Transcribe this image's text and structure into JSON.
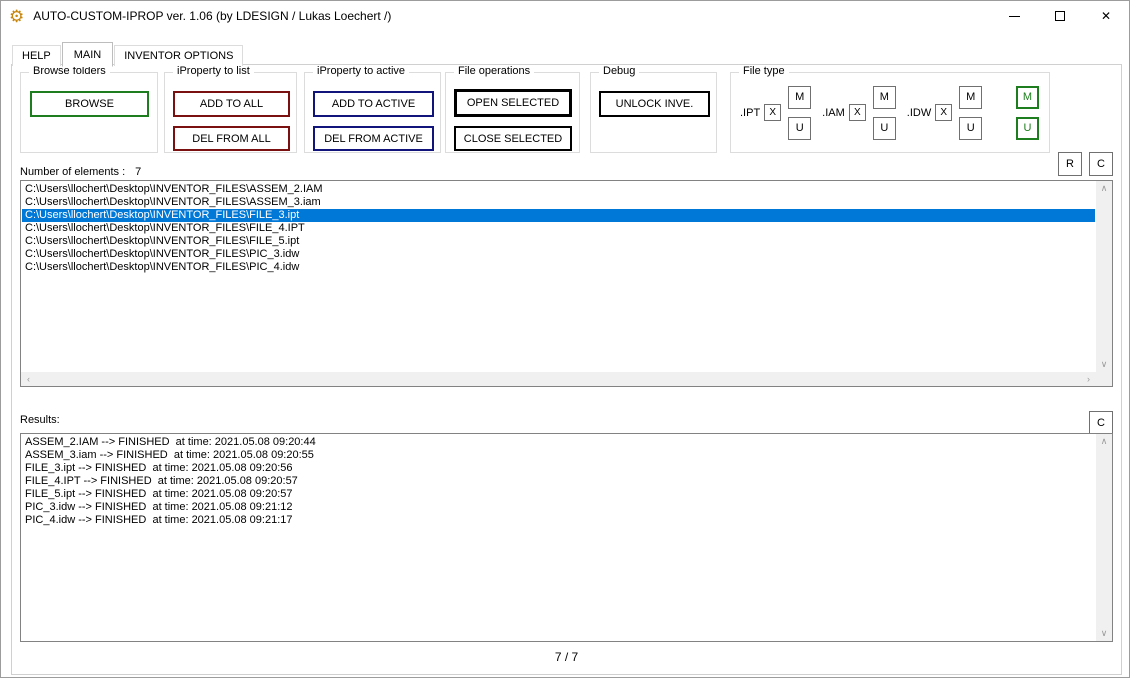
{
  "window": {
    "title": "AUTO-CUSTOM-IPROP ver. 1.06 (by LDESIGN / Lukas Loechert /)",
    "close_glyph": "✕"
  },
  "tabs": [
    {
      "label": "HELP"
    },
    {
      "label": "MAIN",
      "active": true
    },
    {
      "label": "INVENTOR OPTIONS"
    }
  ],
  "groups": {
    "browse_folders": {
      "title": "Browse folders",
      "browse": "BROWSE"
    },
    "iproperty_to_list": {
      "title": "iProperty to list",
      "add_to_all": "ADD TO ALL",
      "del_from_all": "DEL FROM ALL"
    },
    "iproperty_to_active": {
      "title": "iProperty to active",
      "add_to_active": "ADD TO ACTIVE",
      "del_from_active": "DEL FROM ACTIVE"
    },
    "file_operations": {
      "title": "File operations",
      "open_selected": "OPEN SELECTED",
      "close_selected": "CLOSE SELECTED"
    },
    "debug": {
      "title": "Debug",
      "unlock": "UNLOCK INVE."
    },
    "file_type": {
      "title": "File type",
      "types": [
        {
          "label": ".IPT",
          "x": "X",
          "m": "M",
          "u": "U"
        },
        {
          "label": ".IAM",
          "x": "X",
          "m": "M",
          "u": "U"
        },
        {
          "label": ".IDW",
          "x": "X",
          "m": "M",
          "u": "U"
        }
      ],
      "all_m": "M",
      "all_u": "U"
    }
  },
  "toolbar": {
    "r_button": "R",
    "c_button_top": "C",
    "c_button_results": "C"
  },
  "file_list": {
    "count_label": "Number of elements :",
    "count_value": "7",
    "items": [
      {
        "path": "C:\\Users\\llochert\\Desktop\\INVENTOR_FILES\\ASSEM_2.IAM"
      },
      {
        "path": "C:\\Users\\llochert\\Desktop\\INVENTOR_FILES\\ASSEM_3.iam"
      },
      {
        "path": "C:\\Users\\llochert\\Desktop\\INVENTOR_FILES\\FILE_3.ipt",
        "selected": true
      },
      {
        "path": "C:\\Users\\llochert\\Desktop\\INVENTOR_FILES\\FILE_4.IPT"
      },
      {
        "path": "C:\\Users\\llochert\\Desktop\\INVENTOR_FILES\\FILE_5.ipt"
      },
      {
        "path": "C:\\Users\\llochert\\Desktop\\INVENTOR_FILES\\PIC_3.idw"
      },
      {
        "path": "C:\\Users\\llochert\\Desktop\\INVENTOR_FILES\\PIC_4.idw"
      }
    ]
  },
  "results": {
    "label": "Results:",
    "lines": [
      {
        "text": "ASSEM_2.IAM --> FINISHED  at time: 2021.05.08 09:20:44"
      },
      {
        "text": "ASSEM_3.iam --> FINISHED  at time: 2021.05.08 09:20:55"
      },
      {
        "text": "FILE_3.ipt --> FINISHED  at time: 2021.05.08 09:20:56"
      },
      {
        "text": "FILE_4.IPT --> FINISHED  at time: 2021.05.08 09:20:57"
      },
      {
        "text": "FILE_5.ipt --> FINISHED  at time: 2021.05.08 09:20:57"
      },
      {
        "text": "PIC_3.idw --> FINISHED  at time: 2021.05.08 09:21:12"
      },
      {
        "text": "PIC_4.idw --> FINISHED  at time: 2021.05.08 09:21:17"
      }
    ]
  },
  "status": {
    "progress": "7 / 7"
  },
  "colors": {
    "selection": "#0078d7",
    "green_accent": "#1e7d1e",
    "dark_red_accent": "#7b1010",
    "navy_accent": "#10147b",
    "gear_icon": "#c8860a"
  }
}
